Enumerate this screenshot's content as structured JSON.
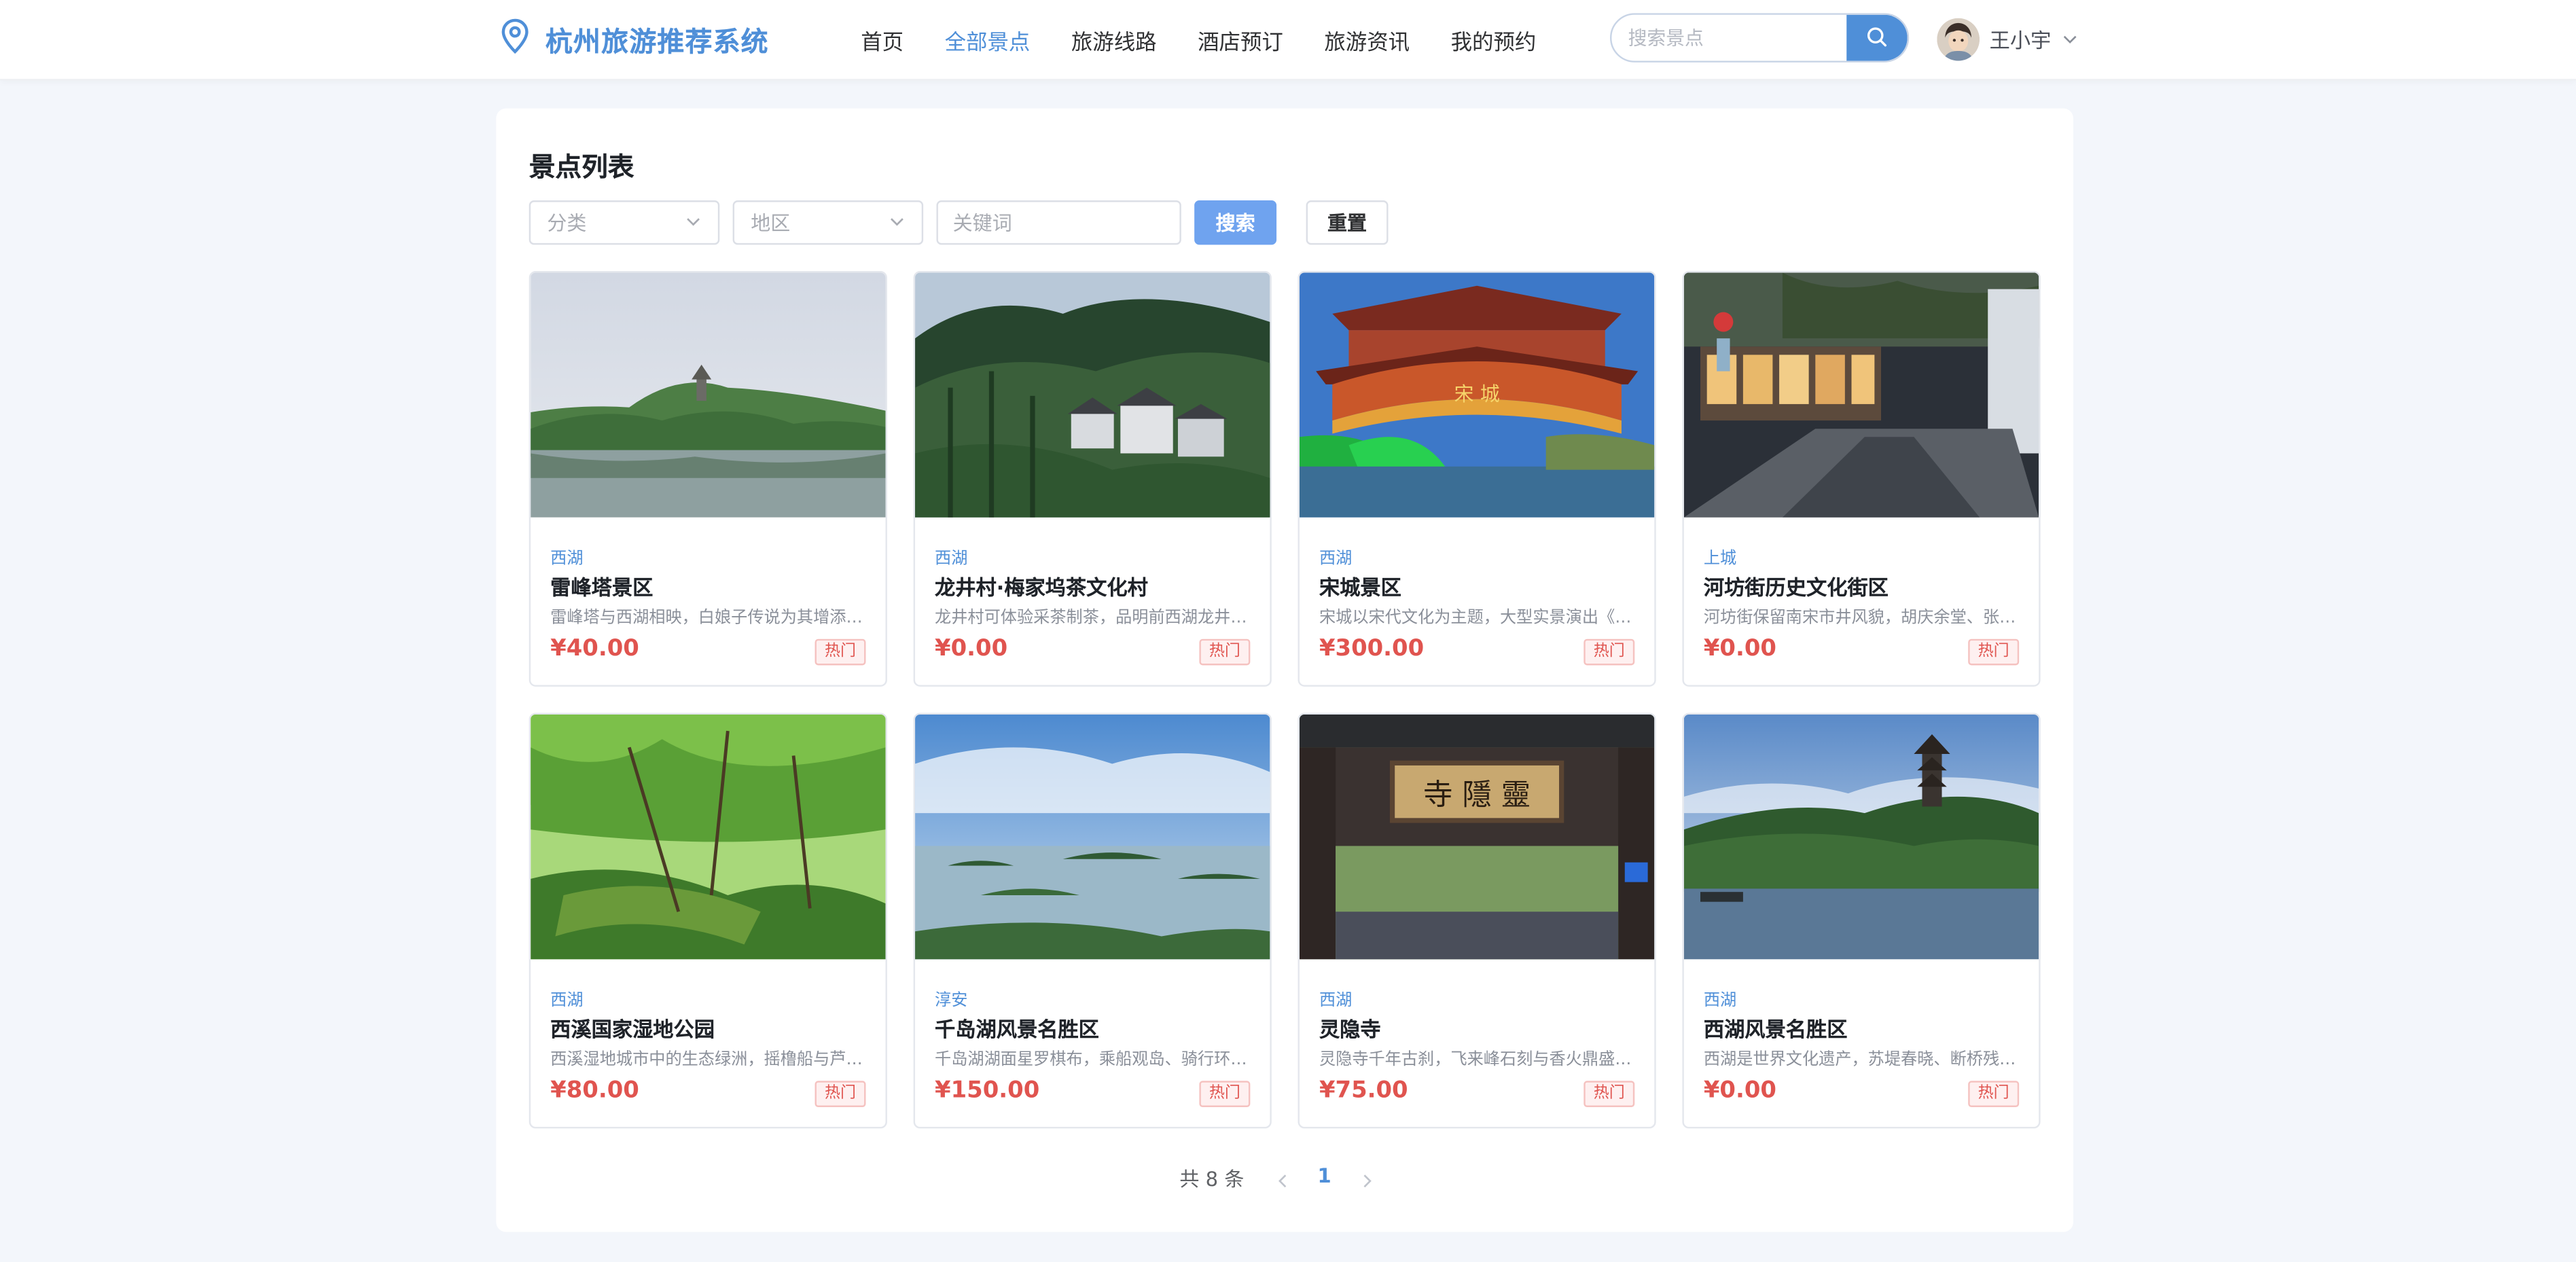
{
  "app": {
    "title": "杭州旅游推荐系统",
    "brand_color": "#4f8fd8",
    "price_color": "#e0544f"
  },
  "nav": {
    "items": [
      {
        "label": "首页",
        "active": false
      },
      {
        "label": "全部景点",
        "active": true
      },
      {
        "label": "旅游线路",
        "active": false
      },
      {
        "label": "酒店预订",
        "active": false
      },
      {
        "label": "旅游资讯",
        "active": false
      },
      {
        "label": "我的预约",
        "active": false
      }
    ]
  },
  "search": {
    "placeholder": "搜索景点",
    "value": ""
  },
  "user": {
    "name": "王小宇"
  },
  "main": {
    "title": "景点列表",
    "filters": {
      "category_placeholder": "分类",
      "region_placeholder": "地区",
      "keyword_placeholder": "关键词",
      "search_label": "搜索",
      "reset_label": "重置"
    },
    "cards": [
      {
        "region": "西湖",
        "name": "雷峰塔景区",
        "desc": "雷峰塔与西湖相映，白娘子传说为其增添…",
        "price": "¥40.00",
        "tag": "热门",
        "image": "leifeng-pagoda-lake"
      },
      {
        "region": "西湖",
        "name": "龙井村·梅家坞茶文化村",
        "desc": "龙井村可体验采茶制茶，品明前西湖龙井…",
        "price": "¥0.00",
        "tag": "热门",
        "image": "longjing-tea-village"
      },
      {
        "region": "西湖",
        "name": "宋城景区",
        "desc": "宋城以宋代文化为主题，大型实景演出《…",
        "price": "¥300.00",
        "tag": "热门",
        "image": "songcheng-gate"
      },
      {
        "region": "上城",
        "name": "河坊街历史文化街区",
        "desc": "河坊街保留南宋市井风貌，胡庆余堂、张…",
        "price": "¥0.00",
        "tag": "热门",
        "image": "hefang-street"
      },
      {
        "region": "西湖",
        "name": "西溪国家湿地公园",
        "desc": "西溪湿地城市中的生态绿洲，摇橹船与芦…",
        "price": "¥80.00",
        "tag": "热门",
        "image": "xixi-wetland"
      },
      {
        "region": "淳安",
        "name": "千岛湖风景名胜区",
        "desc": "千岛湖湖面星罗棋布，乘船观岛、骑行环…",
        "price": "¥150.00",
        "tag": "热门",
        "image": "qiandao-lake"
      },
      {
        "region": "西湖",
        "name": "灵隐寺",
        "desc": "灵隐寺千年古刹，飞来峰石刻与香火鼎盛…",
        "price": "¥75.00",
        "tag": "热门",
        "image": "lingyin-temple-gate"
      },
      {
        "region": "西湖",
        "name": "西湖风景名胜区",
        "desc": "西湖是世界文化遗产，苏堤春晓、断桥残…",
        "price": "¥0.00",
        "tag": "热门",
        "image": "west-lake-pagoda"
      }
    ],
    "pagination": {
      "total_text": "共 8 条",
      "current": "1"
    }
  }
}
